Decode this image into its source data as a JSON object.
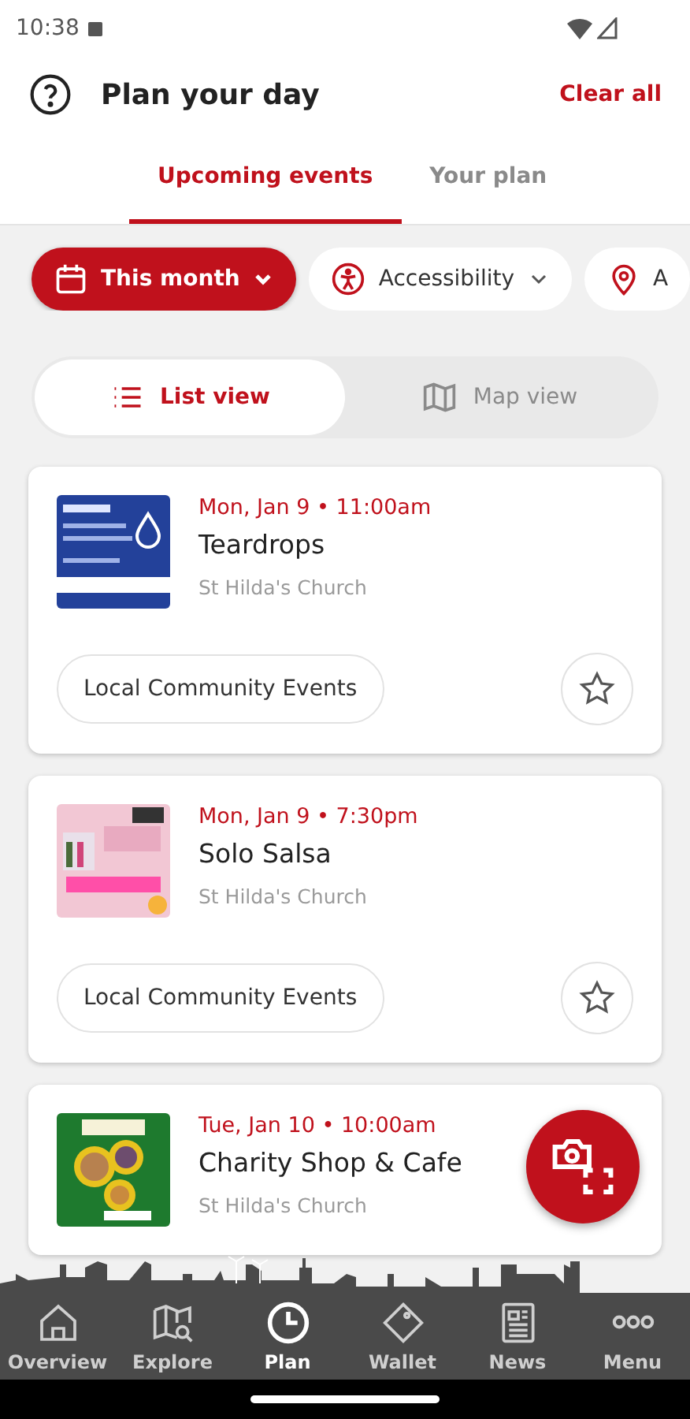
{
  "status_bar": {
    "time": "10:38"
  },
  "header": {
    "title": "Plan your day",
    "action": "Clear all"
  },
  "tabs": [
    {
      "label": "Upcoming events",
      "selected": true
    },
    {
      "label": "Your plan",
      "selected": false
    }
  ],
  "filters": [
    {
      "kind": "calendar",
      "label": "This month",
      "selected": true
    },
    {
      "kind": "accessibility",
      "label": "Accessibility",
      "selected": false
    },
    {
      "kind": "location",
      "label": "A",
      "selected": false
    }
  ],
  "view_toggle": [
    {
      "kind": "list",
      "label": "List view",
      "selected": true
    },
    {
      "kind": "map",
      "label": "Map view",
      "selected": false
    }
  ],
  "events": [
    {
      "when": "Mon, Jan 9 • 11:00am",
      "title": "Teardrops",
      "venue": "St Hilda's Church",
      "category": "Local Community Events",
      "starred": false
    },
    {
      "when": "Mon, Jan 9 • 7:30pm",
      "title": "Solo Salsa",
      "venue": "St Hilda's Church",
      "category": "Local Community Events",
      "starred": false
    },
    {
      "when": "Tue, Jan 10 • 10:00am",
      "title": "Charity Shop & Cafe",
      "venue": "St Hilda's Church"
    }
  ],
  "bottom_nav": [
    {
      "kind": "home",
      "label": "Overview",
      "selected": false
    },
    {
      "kind": "map",
      "label": "Explore",
      "selected": false
    },
    {
      "kind": "clock",
      "label": "Plan",
      "selected": true
    },
    {
      "kind": "wallet",
      "label": "Wallet",
      "selected": false
    },
    {
      "kind": "news",
      "label": "News",
      "selected": false
    },
    {
      "kind": "menu",
      "label": "Menu",
      "selected": false
    }
  ]
}
